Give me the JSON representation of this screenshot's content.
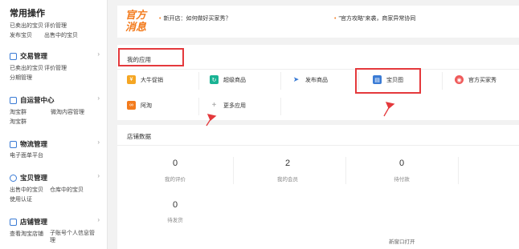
{
  "sidebar": {
    "title": "常用操作",
    "quick": [
      "已卖出的宝贝",
      "评价管理",
      "发布宝贝",
      "出售中的宝贝"
    ],
    "sections": [
      {
        "title": "交易管理",
        "links": [
          "已卖出的宝贝",
          "评价管理",
          "分期管理"
        ]
      },
      {
        "title": "自运营中心",
        "links": [
          "淘宝群",
          "微淘内容管理",
          "淘宝群"
        ]
      },
      {
        "title": "物流管理",
        "links": [
          "电子面单平台"
        ]
      },
      {
        "title": "宝贝管理",
        "links": [
          "出售中的宝贝",
          "仓库中的宝贝",
          "使用认证"
        ]
      },
      {
        "title": "店铺管理",
        "links": [
          "查看淘宝店铺",
          "子账号个人信息管理"
        ]
      }
    ]
  },
  "messages": {
    "title": "官方消息",
    "items": [
      "新开店：如何做好买家秀？",
      "\"官方攻略\"来袭，商家异常协同"
    ]
  },
  "apps": {
    "title": "我的应用",
    "items": [
      {
        "label": "大牛促销",
        "icon": "promo-icon",
        "color": "#f5a623"
      },
      {
        "label": "超级商品",
        "icon": "refresh-icon",
        "color": "#1ab394"
      },
      {
        "label": "发布商品",
        "icon": "paper-plane-icon",
        "color": "#3a7bd5"
      },
      {
        "label": "宝贝图",
        "icon": "clipboard-icon",
        "color": "#3a7bd5"
      },
      {
        "label": "官方买家秀",
        "icon": "camera-icon",
        "color": "#ef5b5b"
      },
      {
        "label": "阿淘",
        "icon": "chat-icon",
        "color": "#f37b1d"
      },
      {
        "label": "更多应用",
        "icon": "plus-icon",
        "color": "#999999"
      }
    ]
  },
  "shop": {
    "title": "店铺数据",
    "stats": [
      {
        "value": "0",
        "label": "我的评价"
      },
      {
        "value": "2",
        "label": "我的会员"
      },
      {
        "value": "0",
        "label": "待付款"
      },
      {
        "value": "0",
        "label": "待发货"
      }
    ],
    "footer": "新窗口打开"
  }
}
